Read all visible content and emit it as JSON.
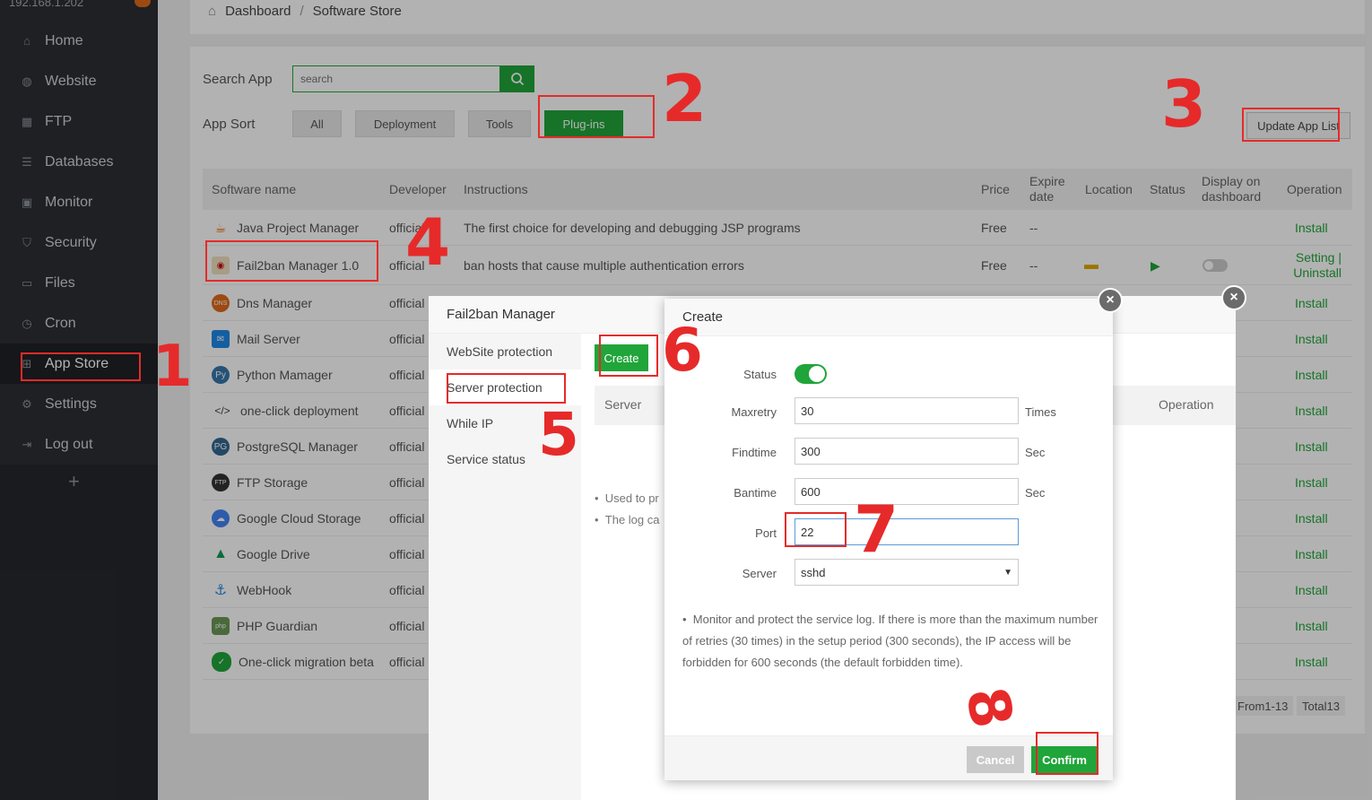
{
  "sidebar": {
    "host": "192.168.1.202",
    "items": [
      {
        "label": "Home",
        "icon": "home-icon"
      },
      {
        "label": "Website",
        "icon": "globe-icon"
      },
      {
        "label": "FTP",
        "icon": "ftp-icon"
      },
      {
        "label": "Databases",
        "icon": "database-icon"
      },
      {
        "label": "Monitor",
        "icon": "monitor-icon"
      },
      {
        "label": "Security",
        "icon": "shield-icon"
      },
      {
        "label": "Files",
        "icon": "folder-icon"
      },
      {
        "label": "Cron",
        "icon": "clock-icon"
      },
      {
        "label": "App Store",
        "icon": "grid-icon"
      },
      {
        "label": "Settings",
        "icon": "gear-icon"
      },
      {
        "label": "Log out",
        "icon": "logout-icon"
      }
    ],
    "add": "+"
  },
  "breadcrumb": {
    "home": "Dashboard",
    "sep": "/",
    "current": "Software Store"
  },
  "search": {
    "label": "Search App",
    "placeholder": "search"
  },
  "sort": {
    "label": "App Sort",
    "options": [
      "All",
      "Deployment",
      "Tools",
      "Plug-ins"
    ],
    "active": "Plug-ins"
  },
  "update_button": "Update App List",
  "table": {
    "headers": {
      "name": "Software name",
      "developer": "Developer",
      "instructions": "Instructions",
      "price": "Price",
      "expire": "Expire date",
      "location": "Location",
      "status": "Status",
      "display": "Display on dashboard",
      "operation": "Operation"
    },
    "rows": [
      {
        "name": "Java Project Manager",
        "developer": "official",
        "instructions": "The first choice for developing and debugging JSP programs",
        "price": "Free",
        "expire": "--",
        "op": "Install"
      },
      {
        "name": "Fail2ban Manager 1.0",
        "developer": "official",
        "instructions": "ban hosts that cause multiple authentication errors",
        "price": "Free",
        "expire": "--",
        "op1": "Setting |",
        "op2": "Uninstall"
      },
      {
        "name": "Dns Manager",
        "developer": "official",
        "op": "Install"
      },
      {
        "name": "Mail Server",
        "developer": "official",
        "op": "Install"
      },
      {
        "name": "Python Mamager",
        "developer": "official",
        "op": "Install"
      },
      {
        "name": "one-click deployment",
        "developer": "official",
        "op": "Install"
      },
      {
        "name": "PostgreSQL Manager",
        "developer": "official",
        "op": "Install"
      },
      {
        "name": "FTP Storage",
        "developer": "official",
        "op": "Install"
      },
      {
        "name": "Google Cloud Storage",
        "developer": "official",
        "op": "Install"
      },
      {
        "name": "Google Drive",
        "developer": "official",
        "op": "Install"
      },
      {
        "name": "WebHook",
        "developer": "official",
        "op": "Install"
      },
      {
        "name": "PHP Guardian",
        "developer": "official",
        "op": "Install"
      },
      {
        "name": "One-click migration beta",
        "developer": "official",
        "op": "Install"
      }
    ]
  },
  "pager": {
    "range": "From1-13",
    "total": "Total13"
  },
  "f2b_modal": {
    "title": "Fail2ban Manager",
    "tabs": [
      "WebSite protection",
      "Server protection",
      "While IP",
      "Service status"
    ],
    "create_button": "Create",
    "col_server": "Server",
    "col_operation": "Operation",
    "notes": [
      "Used to pr",
      "The log ca"
    ]
  },
  "create_modal": {
    "title": "Create",
    "fields": {
      "status": "Status",
      "maxretry": "Maxretry",
      "maxretry_value": "30",
      "maxretry_unit": "Times",
      "findtime": "Findtime",
      "findtime_value": "300",
      "findtime_unit": "Sec",
      "bantime": "Bantime",
      "bantime_value": "600",
      "bantime_unit": "Sec",
      "port": "Port",
      "port_value": "22",
      "server": "Server",
      "server_value": "sshd"
    },
    "tip": "Monitor and protect the service log. If there is more than the maximum number of retries (30 times) in the setup period (300 seconds), the IP access will be forbidden for 600 seconds (the default forbidden time).",
    "cancel": "Cancel",
    "confirm": "Confirm"
  },
  "annotations": [
    "1",
    "2",
    "3",
    "4",
    "5",
    "6",
    "7",
    "8"
  ],
  "colors": {
    "accent": "#20a53a",
    "annotation": "#e62a2a",
    "sidebar": "#2b2f33"
  }
}
